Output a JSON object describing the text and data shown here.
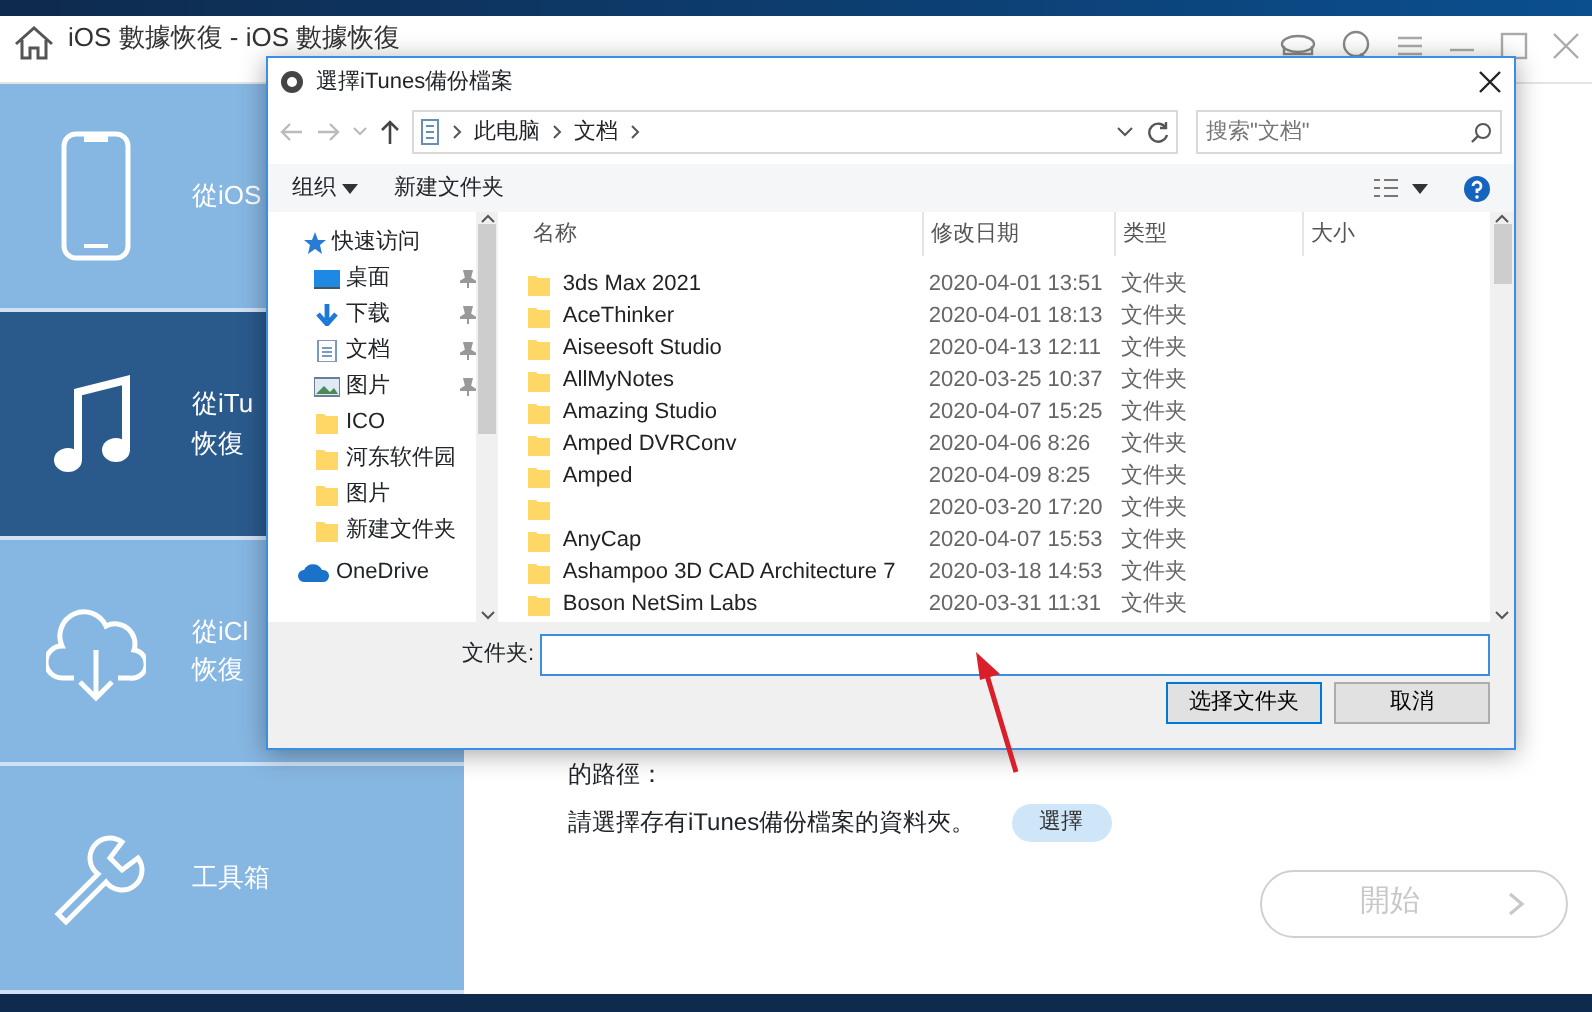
{
  "app": {
    "title": "iOS 數據恢復 - iOS 數據恢復"
  },
  "sidebar": {
    "items": [
      {
        "kind": "phone",
        "lines": [
          "從iOS"
        ],
        "selected": false
      },
      {
        "kind": "music",
        "lines": [
          "從iTu",
          "恢復"
        ],
        "selected": true
      },
      {
        "kind": "cloud",
        "lines": [
          "從iCl",
          "恢復"
        ],
        "selected": false
      },
      {
        "kind": "tools",
        "lines": [
          "工具箱"
        ],
        "selected": false
      }
    ]
  },
  "main": {
    "path_label": "的路徑：",
    "instruction": "請選擇存有iTunes備份檔案的資料夾。",
    "choose_button": "選擇",
    "start_button": {
      "label": "開始",
      "disabled": true
    }
  },
  "dialog": {
    "title": "選擇iTunes備份檔案",
    "breadcrumb": [
      "此电脑",
      "文档"
    ],
    "search": {
      "placeholder": "搜索\"文档\""
    },
    "toolbar": {
      "organize": "组织",
      "new_folder": "新建文件夹"
    },
    "nav": {
      "quick_access": "快速访问",
      "items": [
        {
          "kind": "desktop",
          "label": "桌面",
          "pinned": true
        },
        {
          "kind": "download",
          "label": "下载",
          "pinned": true
        },
        {
          "kind": "document",
          "label": "文档",
          "pinned": true
        },
        {
          "kind": "picture",
          "label": "图片",
          "pinned": true
        },
        {
          "kind": "folder",
          "label": "ICO",
          "pinned": false
        },
        {
          "kind": "folder",
          "label": "河东软件园",
          "pinned": false
        },
        {
          "kind": "folder",
          "label": "图片",
          "pinned": false
        },
        {
          "kind": "folder",
          "label": "新建文件夹",
          "pinned": false
        }
      ],
      "onedrive": "OneDrive"
    },
    "columns": [
      "名称",
      "修改日期",
      "类型",
      "大小"
    ],
    "rows": [
      {
        "name": "3ds Max 2021",
        "date": "2020-04-01 13:51",
        "type": "文件夹"
      },
      {
        "name": "AceThinker",
        "date": "2020-04-01 18:13",
        "type": "文件夹"
      },
      {
        "name": "Aiseesoft Studio",
        "date": "2020-04-13 12:11",
        "type": "文件夹"
      },
      {
        "name": "AllMyNotes",
        "date": "2020-03-25 10:37",
        "type": "文件夹"
      },
      {
        "name": "Amazing Studio",
        "date": "2020-04-07 15:25",
        "type": "文件夹"
      },
      {
        "name": "Amped DVRConv",
        "date": "2020-04-06 8:26",
        "type": "文件夹"
      },
      {
        "name": "Amped",
        "date": "2020-04-09 8:25",
        "type": "文件夹"
      },
      {
        "date": "2020-03-20 17:20",
        "type": "文件夹"
      },
      {
        "name": "AnyCap",
        "date": "2020-04-07 15:53",
        "type": "文件夹"
      },
      {
        "name": "Ashampoo 3D CAD Architecture 7",
        "date": "2020-03-18 14:53",
        "type": "文件夹"
      },
      {
        "name": "Boson NetSim Labs",
        "date": "2020-03-31 11:31",
        "type": "文件夹"
      }
    ],
    "folder_label": "文件夹:",
    "buttons": [
      {
        "label": "选择文件夹",
        "primary": true
      },
      {
        "label": "取消",
        "primary": false
      }
    ]
  }
}
